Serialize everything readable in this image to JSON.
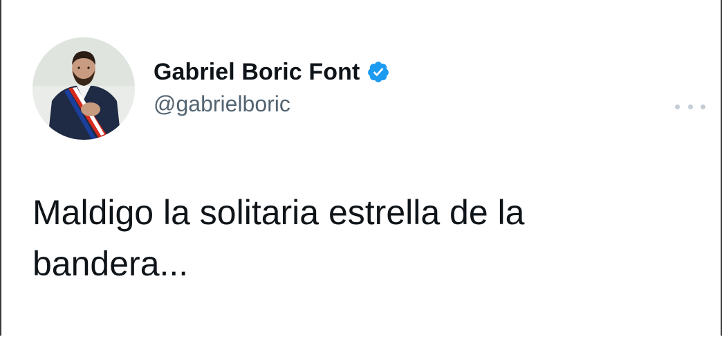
{
  "tweet": {
    "author": {
      "display_name": "Gabriel Boric Font",
      "handle": "@gabrielboric",
      "verified_icon": "verified-badge-icon",
      "avatar_icon": "profile-photo"
    },
    "more_icon": "more-options-icon",
    "text": "Maldigo la solitaria estrella de la\nbandera..."
  },
  "colors": {
    "text_primary": "#0f1419",
    "text_secondary": "#536471",
    "verified_blue": "#1d9bf0"
  }
}
